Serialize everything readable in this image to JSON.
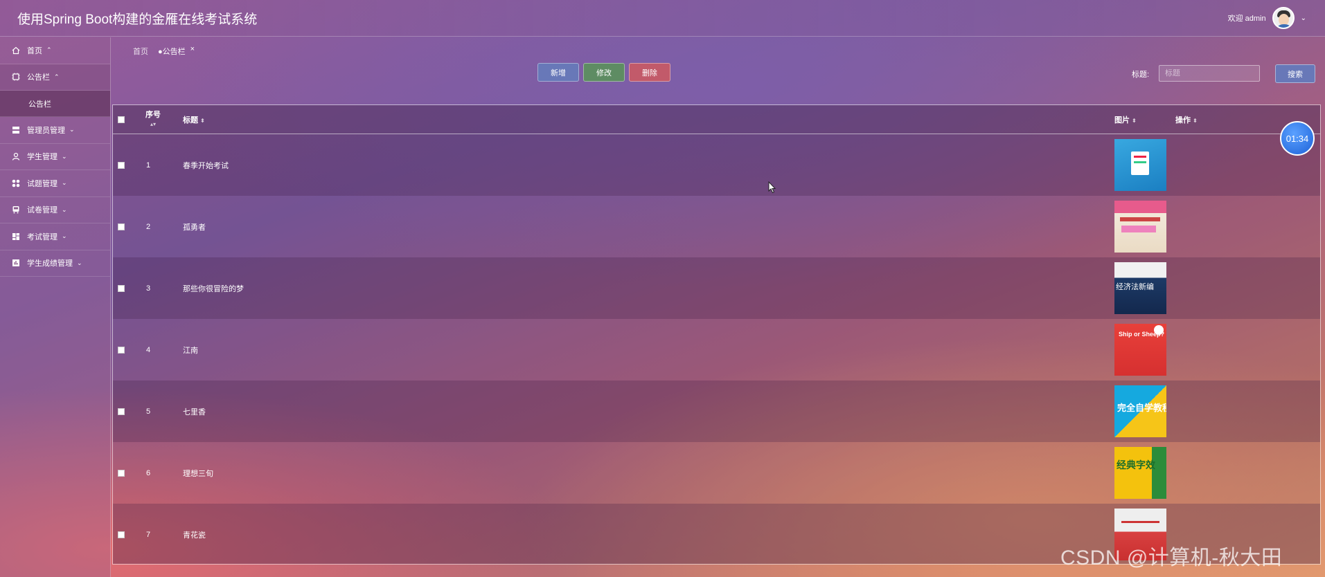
{
  "header": {
    "title": "使用Spring Boot构建的金雁在线考试系统",
    "welcome": "欢迎 admin"
  },
  "sidebar": {
    "items": [
      {
        "label": "首页",
        "arrow": "⌃",
        "icon": "home-icon"
      },
      {
        "label": "公告栏",
        "arrow": "⌃",
        "icon": "notice-icon",
        "sub": [
          "公告栏"
        ]
      },
      {
        "label": "管理员管理",
        "arrow": "⌄",
        "icon": "server-icon"
      },
      {
        "label": "学生管理",
        "arrow": "⌄",
        "icon": "user-icon"
      },
      {
        "label": "试题管理",
        "arrow": "⌄",
        "icon": "grid-icon"
      },
      {
        "label": "试卷管理",
        "arrow": "⌄",
        "icon": "bus-icon"
      },
      {
        "label": "考试管理",
        "arrow": "⌄",
        "icon": "dashboard-icon"
      },
      {
        "label": "学生成绩管理",
        "arrow": "⌄",
        "icon": "chart-box-icon"
      }
    ]
  },
  "tabs": {
    "home": "首页",
    "active": "●公告栏",
    "close": "×"
  },
  "toolbar": {
    "add": "新增",
    "edit": "修改",
    "delete": "删除"
  },
  "search": {
    "label": "标题:",
    "placeholder": "标题",
    "button": "搜索"
  },
  "table": {
    "headers": {
      "index": "序号",
      "title": "标题",
      "image": "图片",
      "ops": "操作"
    },
    "rows": [
      {
        "index": "1",
        "title": "春季开始考试"
      },
      {
        "index": "2",
        "title": "孤勇者"
      },
      {
        "index": "3",
        "title": "那些你很冒险的梦"
      },
      {
        "index": "4",
        "title": "江南"
      },
      {
        "index": "5",
        "title": "七里香"
      },
      {
        "index": "6",
        "title": "理想三旬"
      },
      {
        "index": "7",
        "title": "青花瓷"
      }
    ],
    "thumb_texts": {
      "t3": "经济法新编",
      "t4": "Ship or Sheep?",
      "t5": "完全自学教程",
      "t6": "经典字效"
    }
  },
  "timer": "01:34",
  "watermark": "CSDN @计算机-秋大田"
}
